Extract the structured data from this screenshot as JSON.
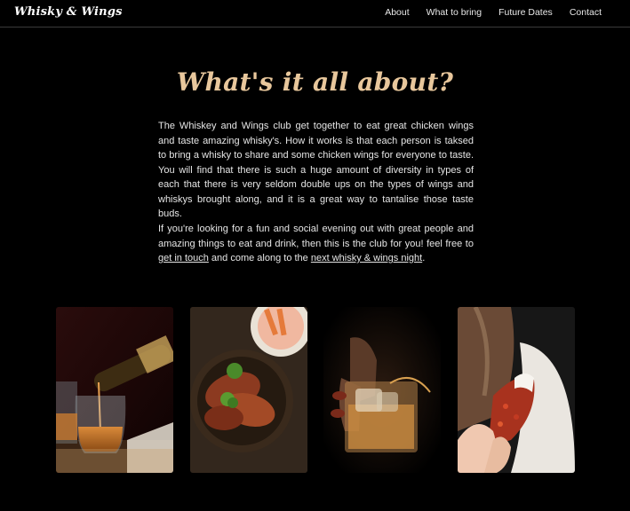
{
  "header": {
    "brand": "Whisky & Wings",
    "nav": [
      {
        "label": "About"
      },
      {
        "label": "What to bring"
      },
      {
        "label": "Future Dates"
      },
      {
        "label": "Contact"
      }
    ]
  },
  "main": {
    "heading": "What's it all about?",
    "paragraph1": "The Whiskey and Wings club get together to eat great chicken wings and taste amazing whisky's. How it works is that each person is taksed to bring a whisky to share and some chicken wings for everyone to taste. You will find that there is such a huge amount of diversity in types of each that there is very seldom double ups on the types of wings and whiskys brought along, and it is a great way to tantalise those taste buds.",
    "paragraph2": {
      "text_before": "If you're looking for a fun and social evening out with great people and amazing things to eat and drink, then this is the club for you! feel free to ",
      "link1": "get in touch",
      "text_middle": " and come along to the ",
      "link2": "next whisky & wings night",
      "text_after": "."
    }
  },
  "gallery": [
    {
      "name": "whisky-pour-photo"
    },
    {
      "name": "chicken-wings-bowl-photo"
    },
    {
      "name": "whisky-glass-hand-photo"
    },
    {
      "name": "wing-dip-photo"
    }
  ]
}
